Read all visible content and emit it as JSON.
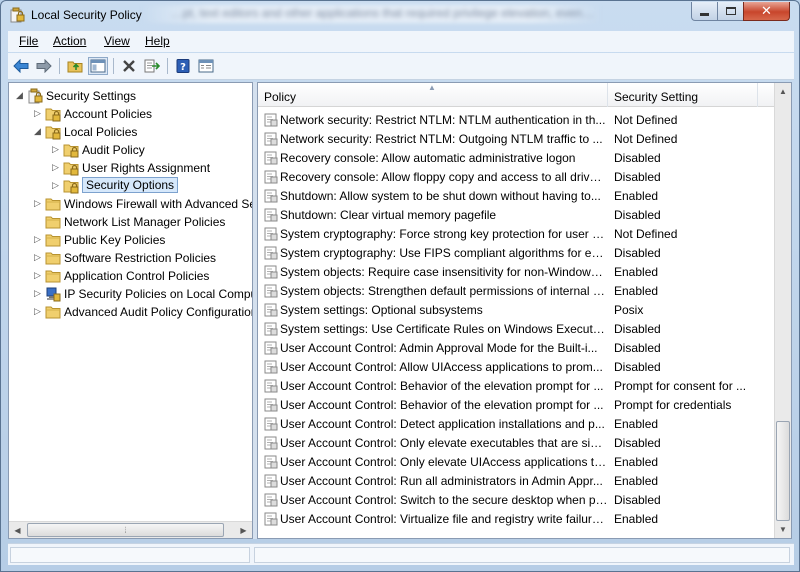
{
  "window": {
    "title": "Local Security Policy",
    "background_text": "…pt, text editors and other applications that required privilege elevation, even…"
  },
  "menu": [
    "File",
    "Action",
    "View",
    "Help"
  ],
  "toolbar": {
    "items": [
      "back-arrow",
      "forward-arrow",
      "up-folder",
      "show-hide-console-tree",
      "delete",
      "export-list",
      "help",
      "properties"
    ]
  },
  "tree": {
    "items": [
      {
        "label": "Security Settings",
        "icon": "security-settings-icon",
        "level": 0,
        "expander": "open"
      },
      {
        "label": "Account Policies",
        "icon": "folder-lock-icon",
        "level": 1,
        "expander": "closed"
      },
      {
        "label": "Local Policies",
        "icon": "folder-lock-icon",
        "level": 1,
        "expander": "open"
      },
      {
        "label": "Audit Policy",
        "icon": "folder-lock-icon",
        "level": 2,
        "expander": "closed"
      },
      {
        "label": "User Rights Assignment",
        "icon": "folder-lock-icon",
        "level": 2,
        "expander": "closed"
      },
      {
        "label": "Security Options",
        "icon": "folder-lock-icon",
        "level": 2,
        "expander": "closed",
        "selected": true
      },
      {
        "label": "Windows Firewall with Advanced Secu",
        "icon": "folder-icon",
        "level": 1,
        "expander": "closed"
      },
      {
        "label": "Network List Manager Policies",
        "icon": "folder-icon",
        "level": 1,
        "expander": "none"
      },
      {
        "label": "Public Key Policies",
        "icon": "folder-icon",
        "level": 1,
        "expander": "closed"
      },
      {
        "label": "Software Restriction Policies",
        "icon": "folder-icon",
        "level": 1,
        "expander": "closed"
      },
      {
        "label": "Application Control Policies",
        "icon": "folder-icon",
        "level": 1,
        "expander": "closed"
      },
      {
        "label": "IP Security Policies on Local Compute",
        "icon": "ip-security-icon",
        "level": 1,
        "expander": "closed"
      },
      {
        "label": "Advanced Audit Policy Configuration",
        "icon": "folder-icon",
        "level": 1,
        "expander": "closed"
      }
    ]
  },
  "list": {
    "columns": {
      "policy": "Policy",
      "setting": "Security Setting"
    },
    "rows": [
      {
        "policy": "Network security: Restrict NTLM: NTLM authentication in th...",
        "setting": "Not Defined"
      },
      {
        "policy": "Network security: Restrict NTLM: Outgoing NTLM traffic to ...",
        "setting": "Not Defined"
      },
      {
        "policy": "Recovery console: Allow automatic administrative logon",
        "setting": "Disabled"
      },
      {
        "policy": "Recovery console: Allow floppy copy and access to all drives...",
        "setting": "Disabled"
      },
      {
        "policy": "Shutdown: Allow system to be shut down without having to...",
        "setting": "Enabled"
      },
      {
        "policy": "Shutdown: Clear virtual memory pagefile",
        "setting": "Disabled"
      },
      {
        "policy": "System cryptography: Force strong key protection for user k...",
        "setting": "Not Defined"
      },
      {
        "policy": "System cryptography: Use FIPS compliant algorithms for en...",
        "setting": "Disabled"
      },
      {
        "policy": "System objects: Require case insensitivity for non-Windows ...",
        "setting": "Enabled"
      },
      {
        "policy": "System objects: Strengthen default permissions of internal s...",
        "setting": "Enabled"
      },
      {
        "policy": "System settings: Optional subsystems",
        "setting": "Posix"
      },
      {
        "policy": "System settings: Use Certificate Rules on Windows Executabl...",
        "setting": "Disabled"
      },
      {
        "policy": "User Account Control: Admin Approval Mode for the Built-i...",
        "setting": "Disabled"
      },
      {
        "policy": "User Account Control: Allow UIAccess applications to prom...",
        "setting": "Disabled"
      },
      {
        "policy": "User Account Control: Behavior of the elevation prompt for ...",
        "setting": "Prompt for consent for ..."
      },
      {
        "policy": "User Account Control: Behavior of the elevation prompt for ...",
        "setting": "Prompt for credentials"
      },
      {
        "policy": "User Account Control: Detect application installations and p...",
        "setting": "Enabled"
      },
      {
        "policy": "User Account Control: Only elevate executables that are sign...",
        "setting": "Disabled"
      },
      {
        "policy": "User Account Control: Only elevate UIAccess applications th...",
        "setting": "Enabled"
      },
      {
        "policy": "User Account Control: Run all administrators in Admin Appr...",
        "setting": "Enabled"
      },
      {
        "policy": "User Account Control: Switch to the secure desktop when pr...",
        "setting": "Disabled"
      },
      {
        "policy": "User Account Control: Virtualize file and registry write failure...",
        "setting": "Enabled"
      }
    ]
  },
  "colors": {
    "selection_bg": "#d6e8fb",
    "selection_border": "#7da2ce",
    "folder": "#e8c25a",
    "lock": "#c89a1a"
  }
}
